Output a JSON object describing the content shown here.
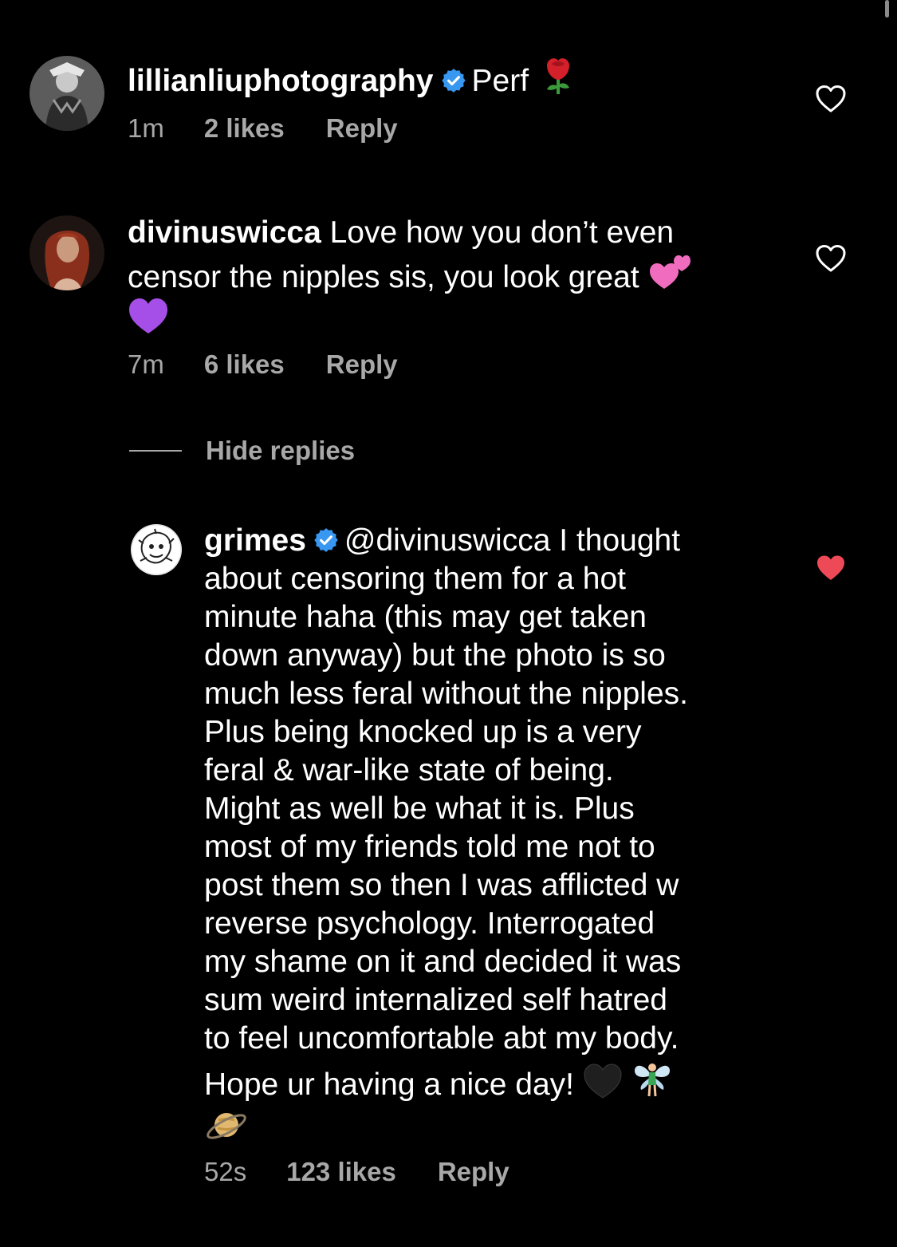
{
  "comments": [
    {
      "username": "lillianliuphotography",
      "verified": true,
      "text": "Perf",
      "emoji": [
        "rose-emoji"
      ],
      "time": "1m",
      "likes": "2 likes",
      "reply_label": "Reply",
      "liked": false
    },
    {
      "username": "divinuswicca",
      "verified": false,
      "text_line1": "Love how you don’t even",
      "text_line2": "censor the nipples sis, you look great",
      "emoji": [
        "two-hearts-emoji",
        "purple-heart-emoji"
      ],
      "time": "7m",
      "likes": "6 likes",
      "reply_label": "Reply",
      "liked": false
    }
  ],
  "replies_toggle": {
    "label": "Hide replies"
  },
  "reply": {
    "username": "grimes",
    "verified": true,
    "mention": "@divinuswicca",
    "lines": [
      " I thought",
      "about censoring them for a hot",
      "minute haha (this may get taken",
      "down anyway) but the photo is so",
      "much less feral without the nipples.",
      "Plus being knocked up is a very",
      "feral & war-like state of being.",
      "Might as well be what it is.  Plus",
      "most of my friends told me not to",
      "post them so then I was afflicted w",
      "reverse psychology.  Interrogated",
      "my shame on it and decided it was",
      "sum weird internalized self hatred",
      "to feel uncomfortable abt my body.",
      "Hope ur having a nice day! "
    ],
    "emoji": [
      "black-heart-emoji",
      "fairy-emoji",
      "ringed-planet-emoji"
    ],
    "time": "52s",
    "likes": "123 likes",
    "reply_label": "Reply",
    "liked": true
  },
  "colors": {
    "background": "#000000",
    "text": "#ffffff",
    "meta": "#a8a8a8",
    "verified": "#3897f0",
    "liked_heart": "#ed4956"
  }
}
